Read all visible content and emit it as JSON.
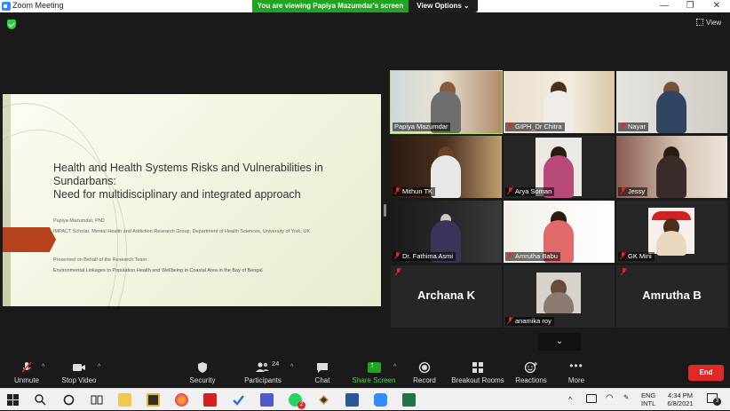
{
  "window": {
    "title": "Zoom Meeting",
    "minimize": "—",
    "maximize": "❐",
    "close": "✕"
  },
  "share_banner": "You are viewing Papiya Mazumdar's screen",
  "view_options": "View Options ⌄",
  "view_button": "View",
  "slide": {
    "title": "Health and Health Systems Risks and Vulnerabilities in Sundarbans:\nNeed for multidisciplinary and integrated approach",
    "author": "Papiya Mazumdar, PhD",
    "affiliation": "IMPACT Scholar, Mental Health and Addiction Research Group, Department of Health Sciences, University of York, UK",
    "presented_on": "Presented on Behalf of the Research Team:",
    "project": "Environmental Linkages to Population Health and Wellbeing in Coastal Area in the Bay of Bengal",
    "accent_color": "#b5421a"
  },
  "participants": [
    {
      "name": "Papiya Mazumdar",
      "video": true,
      "muted": false,
      "active": true
    },
    {
      "name": "GIPH_Dr Chitra",
      "video": true,
      "muted": true
    },
    {
      "name": "Nayar",
      "video": true,
      "muted": true
    },
    {
      "name": "Mithun TK",
      "video": true,
      "muted": true
    },
    {
      "name": "Arya Soman",
      "video": true,
      "muted": true
    },
    {
      "name": "Jessy",
      "video": true,
      "muted": true
    },
    {
      "name": "Dr. Fathima Asmi",
      "video": true,
      "muted": true
    },
    {
      "name": "Amrutha Babu",
      "video": true,
      "muted": true
    },
    {
      "name": "GK Mini",
      "video": true,
      "muted": true
    },
    {
      "name": "Archana K",
      "video": false,
      "muted": true
    },
    {
      "name": "anamika roy",
      "video": true,
      "muted": true
    },
    {
      "name": "Amrutha B",
      "video": false,
      "muted": true
    }
  ],
  "gallery_next": "⌄",
  "toolbar": {
    "unmute": "Unmute",
    "stop_video": "Stop Video",
    "security": "Security",
    "participants": "Participants",
    "participants_count": "24",
    "chat": "Chat",
    "share_screen": "Share Screen",
    "record": "Record",
    "breakout_rooms": "Breakout Rooms",
    "reactions": "Reactions",
    "more": "More",
    "end": "End"
  },
  "taskbar": {
    "language": "ENG",
    "layout": "INTL",
    "time": "4:34 PM",
    "date": "6/8/2021",
    "notification_count": "3",
    "whatsapp_badge": "2"
  }
}
